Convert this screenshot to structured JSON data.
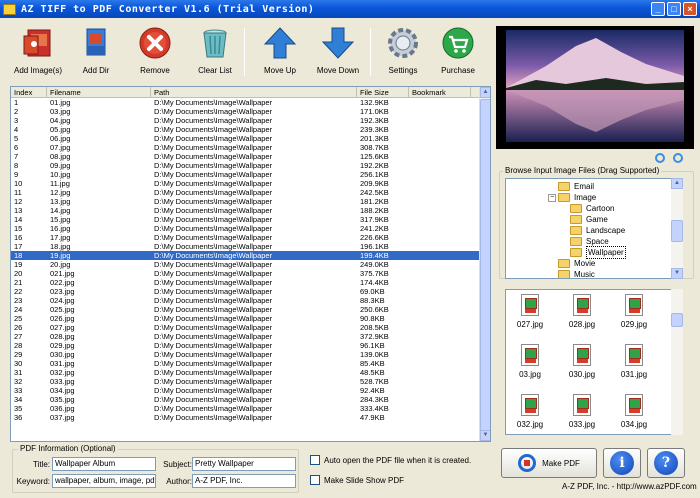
{
  "window": {
    "title": "AZ TIFF to PDF Converter V1.6 (Trial Version)"
  },
  "toolbar": {
    "add_images": "Add Image(s)",
    "add_dir": "Add Dir",
    "remove": "Remove",
    "clear_list": "Clear List",
    "move_up": "Move Up",
    "move_down": "Move Down",
    "settings": "Settings",
    "purchase": "Purchase"
  },
  "colors": {
    "accent": "#0a55d8",
    "selection": "#316ac5",
    "remove_red": "#d33a2a",
    "purchase_green": "#2ea64a"
  },
  "list": {
    "columns": [
      "Index",
      "Filename",
      "Path",
      "File Size",
      "Bookmark"
    ],
    "selected_index": 17,
    "rows": [
      [
        "1",
        "01.jpg",
        "D:\\My Documents\\Image\\Wallpaper",
        "132.9KB"
      ],
      [
        "2",
        "03.jpg",
        "D:\\My Documents\\Image\\Wallpaper",
        "171.0KB"
      ],
      [
        "3",
        "04.jpg",
        "D:\\My Documents\\Image\\Wallpaper",
        "192.3KB"
      ],
      [
        "4",
        "05.jpg",
        "D:\\My Documents\\Image\\Wallpaper",
        "239.3KB"
      ],
      [
        "5",
        "06.jpg",
        "D:\\My Documents\\Image\\Wallpaper",
        "201.3KB"
      ],
      [
        "6",
        "07.jpg",
        "D:\\My Documents\\Image\\Wallpaper",
        "308.7KB"
      ],
      [
        "7",
        "08.jpg",
        "D:\\My Documents\\Image\\Wallpaper",
        "125.6KB"
      ],
      [
        "8",
        "09.jpg",
        "D:\\My Documents\\Image\\Wallpaper",
        "192.2KB"
      ],
      [
        "9",
        "10.jpg",
        "D:\\My Documents\\Image\\Wallpaper",
        "256.1KB"
      ],
      [
        "10",
        "11.jpg",
        "D:\\My Documents\\Image\\Wallpaper",
        "209.9KB"
      ],
      [
        "11",
        "12.jpg",
        "D:\\My Documents\\Image\\Wallpaper",
        "242.5KB"
      ],
      [
        "12",
        "13.jpg",
        "D:\\My Documents\\Image\\Wallpaper",
        "181.2KB"
      ],
      [
        "13",
        "14.jpg",
        "D:\\My Documents\\Image\\Wallpaper",
        "188.2KB"
      ],
      [
        "14",
        "15.jpg",
        "D:\\My Documents\\Image\\Wallpaper",
        "317.9KB"
      ],
      [
        "15",
        "16.jpg",
        "D:\\My Documents\\Image\\Wallpaper",
        "241.2KB"
      ],
      [
        "16",
        "17.jpg",
        "D:\\My Documents\\Image\\Wallpaper",
        "226.6KB"
      ],
      [
        "17",
        "18.jpg",
        "D:\\My Documents\\Image\\Wallpaper",
        "196.1KB"
      ],
      [
        "18",
        "19.jpg",
        "D:\\My Documents\\Image\\Wallpaper",
        "199.4KB"
      ],
      [
        "19",
        "20.jpg",
        "D:\\My Documents\\Image\\Wallpaper",
        "249.0KB"
      ],
      [
        "20",
        "021.jpg",
        "D:\\My Documents\\Image\\Wallpaper",
        "375.7KB"
      ],
      [
        "21",
        "022.jpg",
        "D:\\My Documents\\Image\\Wallpaper",
        "174.4KB"
      ],
      [
        "22",
        "023.jpg",
        "D:\\My Documents\\Image\\Wallpaper",
        "69.0KB"
      ],
      [
        "23",
        "024.jpg",
        "D:\\My Documents\\Image\\Wallpaper",
        "88.3KB"
      ],
      [
        "24",
        "025.jpg",
        "D:\\My Documents\\Image\\Wallpaper",
        "250.6KB"
      ],
      [
        "25",
        "026.jpg",
        "D:\\My Documents\\Image\\Wallpaper",
        "90.8KB"
      ],
      [
        "26",
        "027.jpg",
        "D:\\My Documents\\Image\\Wallpaper",
        "208.5KB"
      ],
      [
        "27",
        "028.jpg",
        "D:\\My Documents\\Image\\Wallpaper",
        "372.9KB"
      ],
      [
        "28",
        "029.jpg",
        "D:\\My Documents\\Image\\Wallpaper",
        "96.1KB"
      ],
      [
        "29",
        "030.jpg",
        "D:\\My Documents\\Image\\Wallpaper",
        "139.0KB"
      ],
      [
        "30",
        "031.jpg",
        "D:\\My Documents\\Image\\Wallpaper",
        "85.4KB"
      ],
      [
        "31",
        "032.jpg",
        "D:\\My Documents\\Image\\Wallpaper",
        "48.5KB"
      ],
      [
        "32",
        "033.jpg",
        "D:\\My Documents\\Image\\Wallpaper",
        "528.7KB"
      ],
      [
        "33",
        "034.jpg",
        "D:\\My Documents\\Image\\Wallpaper",
        "92.4KB"
      ],
      [
        "34",
        "035.jpg",
        "D:\\My Documents\\Image\\Wallpaper",
        "284.3KB"
      ],
      [
        "35",
        "036.jpg",
        "D:\\My Documents\\Image\\Wallpaper",
        "333.4KB"
      ],
      [
        "36",
        "037.jpg",
        "D:\\My Documents\\Image\\Wallpaper",
        "47.9KB"
      ]
    ]
  },
  "browse": {
    "title": "Browse Input Image Files (Drag Supported)",
    "tree": [
      {
        "label": "Email",
        "level": 0
      },
      {
        "label": "Image",
        "level": 0,
        "expanded": true
      },
      {
        "label": "Cartoon",
        "level": 1
      },
      {
        "label": "Game",
        "level": 1
      },
      {
        "label": "Landscape",
        "level": 1
      },
      {
        "label": "Space",
        "level": 1
      },
      {
        "label": "Wallpaper",
        "level": 1,
        "selected": true
      },
      {
        "label": "Movie",
        "level": 0
      },
      {
        "label": "Music",
        "level": 0
      }
    ],
    "thumbnails": [
      "027.jpg",
      "028.jpg",
      "029.jpg",
      "03.jpg",
      "030.jpg",
      "031.jpg",
      "032.jpg",
      "033.jpg",
      "034.jpg"
    ]
  },
  "pdf_info": {
    "title": "PDF Information (Optional)",
    "title_label": "Title:",
    "title_value": "Wallpaper Album",
    "subject_label": "Subject:",
    "subject_value": "Pretty Wallpaper",
    "keyword_label": "Keyword:",
    "keyword_value": "wallpaper, album, image, pdf",
    "author_label": "Author:",
    "author_value": "A-Z PDF, Inc."
  },
  "options": {
    "auto_open": "Auto open the PDF file when it is created.",
    "slide_show": "Make Slide Show PDF"
  },
  "actions": {
    "make_pdf": "Make PDF",
    "info_glyph": "i",
    "help_glyph": "?"
  },
  "footer": "A-Z PDF, Inc. - http://www.azPDF.com"
}
